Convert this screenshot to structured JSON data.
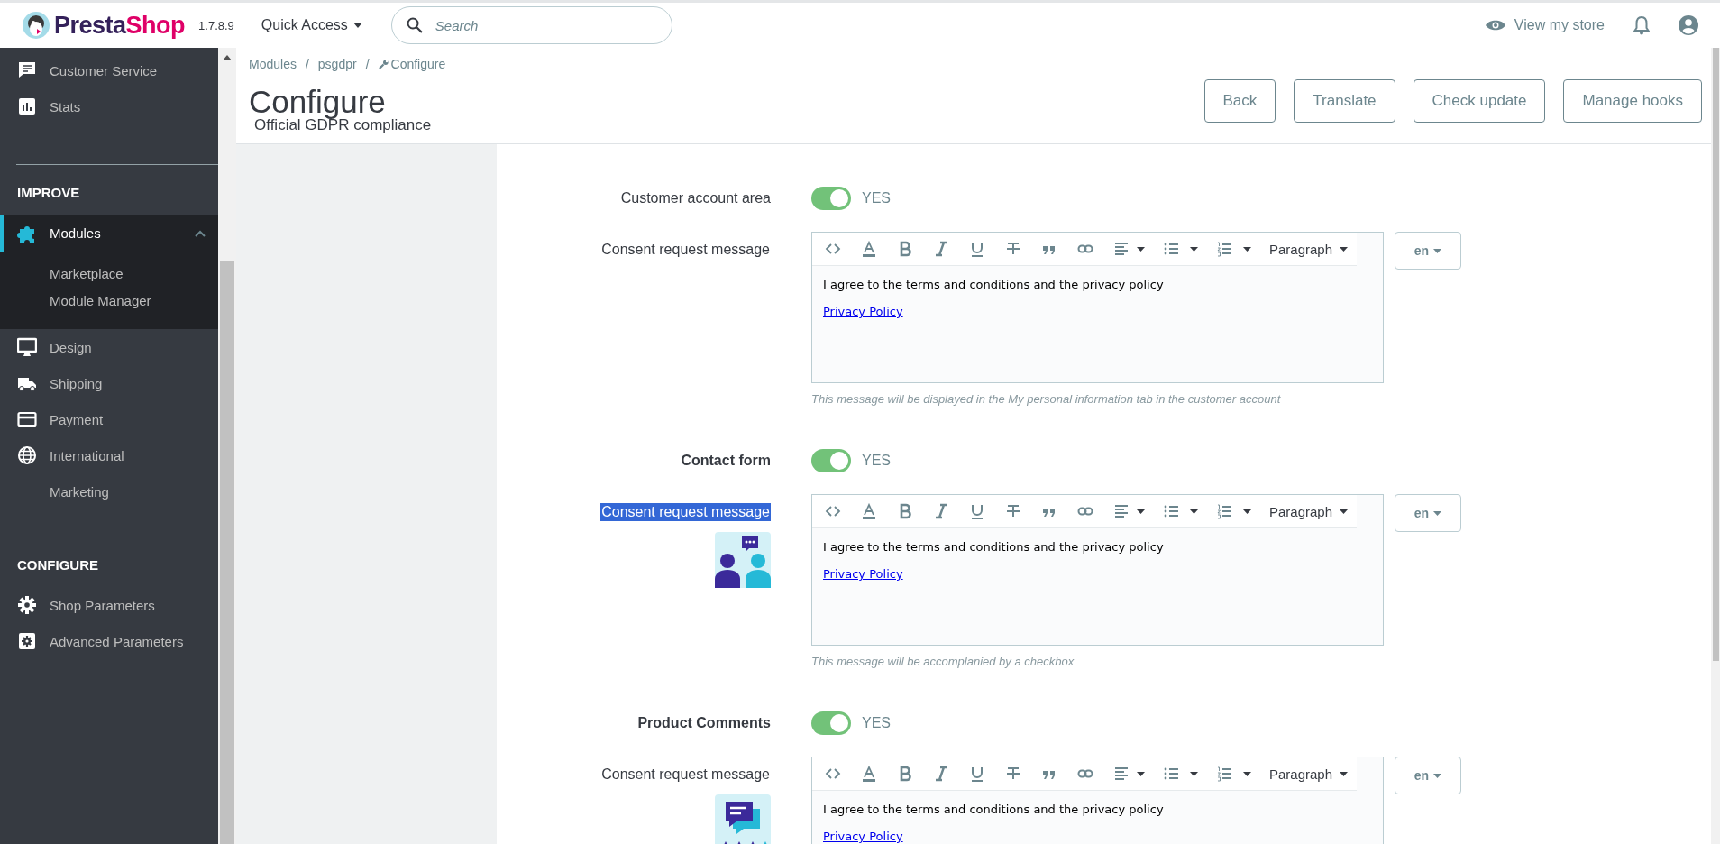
{
  "topbar": {
    "logo": [
      "Presta",
      "Shop"
    ],
    "version": "1.7.8.9",
    "quick_access": "Quick Access",
    "search": {
      "placeholder": "Search"
    },
    "view_store": "View my store"
  },
  "sidebar": {
    "groups": [
      {
        "items": [
          {
            "label": "Customer Service",
            "selected": false
          },
          {
            "label": "Stats",
            "selected": false
          }
        ]
      },
      {
        "title": "IMPROVE",
        "items": [
          {
            "label": "Modules",
            "selected": true,
            "expanded": true,
            "children": [
              {
                "label": "Marketplace"
              },
              {
                "label": "Module Manager"
              }
            ]
          },
          {
            "label": "Design",
            "selected": false
          },
          {
            "label": "Shipping",
            "selected": false
          },
          {
            "label": "Payment",
            "selected": false
          },
          {
            "label": "International",
            "selected": false
          },
          {
            "label": "Marketing",
            "selected": false
          }
        ]
      },
      {
        "title": "CONFIGURE",
        "items": [
          {
            "label": "Shop Parameters",
            "selected": false
          },
          {
            "label": "Advanced Parameters",
            "selected": false
          }
        ]
      }
    ]
  },
  "header": {
    "breadcrumb": {
      "items": [
        "Modules",
        "psgdpr",
        "Configure"
      ],
      "separators": [
        "/",
        "/"
      ]
    },
    "title": "Configure",
    "subtitle": "Official GDPR compliance",
    "buttons": [
      "Back",
      "Translate",
      "Check update",
      "Manage hooks"
    ]
  },
  "sections": [
    {
      "kind": "account",
      "label": "Customer account area",
      "bold": false,
      "toggle": {
        "on": true,
        "text": "YES"
      },
      "consent_label": "Consent request message",
      "highlighted": false,
      "editor": {
        "format": "Paragraph",
        "text": "I agree to the terms and conditions and the privacy policy",
        "link": "Privacy Policy"
      },
      "lang": "en",
      "help": "This message will be displayed in the My personal information tab in the customer account"
    },
    {
      "kind": "contact",
      "label": "Contact form",
      "bold": true,
      "toggle": {
        "on": true,
        "text": "YES"
      },
      "consent_label": "Consent request message",
      "highlighted": true,
      "editor": {
        "format": "Paragraph",
        "text": "I agree to the terms and conditions and the privacy policy",
        "link": "Privacy Policy"
      },
      "lang": "en",
      "help": "This message will be accomplanied by a checkbox"
    },
    {
      "kind": "comments",
      "label": "Product Comments",
      "bold": true,
      "toggle": {
        "on": true,
        "text": "YES"
      },
      "consent_label": "Consent request message",
      "highlighted": false,
      "editor": {
        "format": "Paragraph",
        "text": "I agree to the terms and conditions and the privacy policy",
        "link": "Privacy Policy"
      },
      "lang": "en"
    }
  ]
}
